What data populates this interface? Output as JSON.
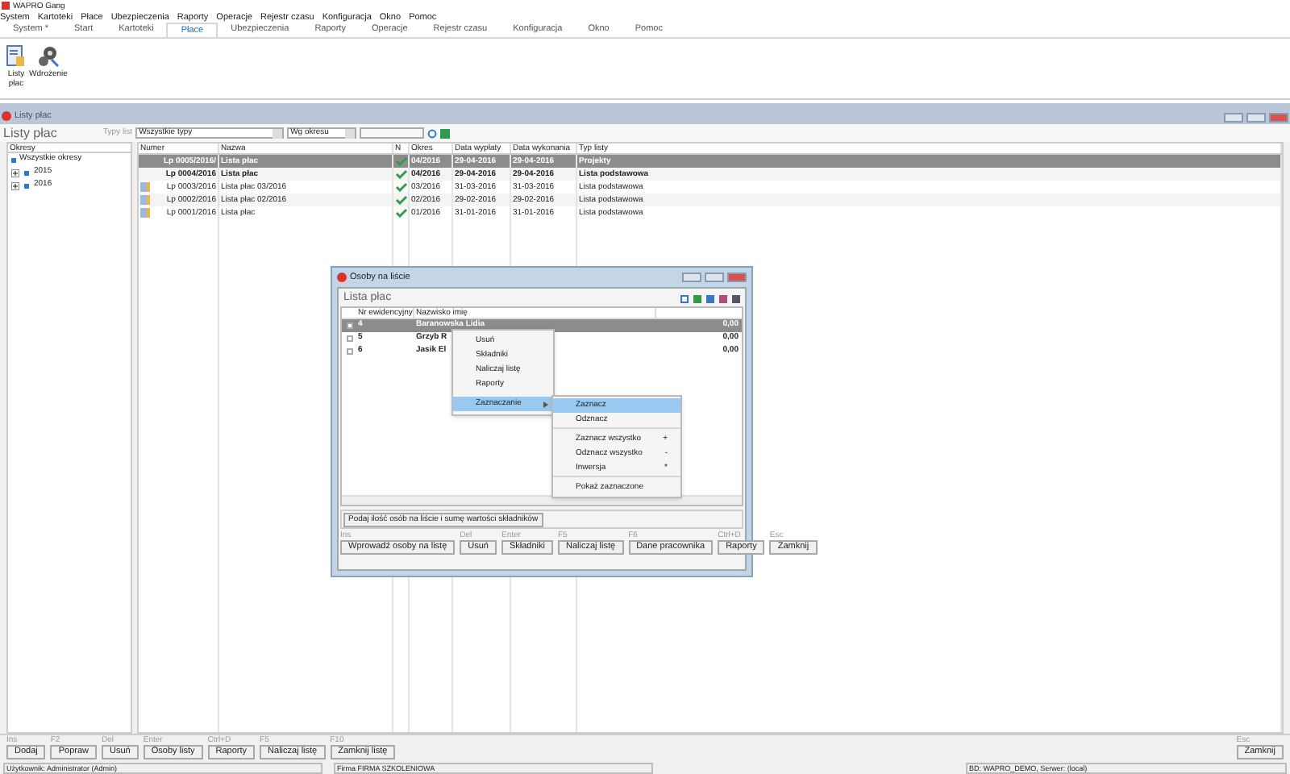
{
  "window": {
    "title": "WAPRO Gang"
  },
  "menu": [
    "System",
    "Kartoteki",
    "Płace",
    "Ubezpieczenia",
    "Raporty",
    "Operacje",
    "Rejestr czasu",
    "Konfiguracja",
    "Okno",
    "Pomoc"
  ],
  "tabs": [
    {
      "label": "System *",
      "selected": false
    },
    {
      "label": "Start",
      "selected": false
    },
    {
      "label": "Kartoteki",
      "selected": false
    },
    {
      "label": "Płace",
      "selected": true
    },
    {
      "label": "Ubezpieczenia",
      "selected": false
    },
    {
      "label": "Raporty",
      "selected": false
    },
    {
      "label": "Operacje",
      "selected": false
    },
    {
      "label": "Rejestr czasu",
      "selected": false
    },
    {
      "label": "Konfiguracja",
      "selected": false
    },
    {
      "label": "Okno",
      "selected": false
    },
    {
      "label": "Pomoc",
      "selected": false
    }
  ],
  "ribbon": [
    {
      "label": "Listy płac",
      "kind": "list"
    },
    {
      "label": "Wdrożenie",
      "kind": "gears"
    }
  ],
  "child_window": {
    "title": "Listy płac",
    "heading": "Listy płac",
    "filter_label": "Typy list",
    "type_value": "Wszystkie typy",
    "period_value": "Wg okresu"
  },
  "tree": {
    "header": "Okresy",
    "root": "Wszystkie okresy",
    "children": [
      {
        "label": "2015",
        "expanded": false
      },
      {
        "label": "2016",
        "expanded": false
      }
    ]
  },
  "table": {
    "columns": [
      "Numer",
      "Nazwa",
      "N",
      "Okres",
      "Data wypłaty",
      "Data wykonania",
      "Typ listy"
    ],
    "rows": [
      {
        "cells": [
          "Lp 0005/2016/",
          "Lista płac",
          "",
          "04/2016",
          "29-04-2016",
          "29-04-2016",
          "Projekty"
        ],
        "checked": true,
        "selected": true,
        "bold": true,
        "document_icon": false
      },
      {
        "cells": [
          "Lp 0004/2016",
          "Lista płac",
          "",
          "04/2016",
          "29-04-2016",
          "29-04-2016",
          "Lista podstawowa"
        ],
        "checked": true,
        "selected": false,
        "bold": true,
        "document_icon": false
      },
      {
        "cells": [
          "Lp 0003/2016",
          "Lista płac 03/2016",
          "",
          "03/2016",
          "31-03-2016",
          "31-03-2016",
          "Lista podstawowa"
        ],
        "checked": true,
        "selected": false,
        "bold": false,
        "document_icon": true
      },
      {
        "cells": [
          "Lp 0002/2016",
          "Lista płac 02/2016",
          "",
          "02/2016",
          "29-02-2016",
          "29-02-2016",
          "Lista podstawowa"
        ],
        "checked": true,
        "selected": false,
        "bold": false,
        "document_icon": true
      },
      {
        "cells": [
          "Lp 0001/2016",
          "Lista płac",
          "",
          "01/2016",
          "31-01-2016",
          "31-01-2016",
          "Lista podstawowa"
        ],
        "checked": true,
        "selected": false,
        "bold": false,
        "document_icon": true
      }
    ]
  },
  "bottom_actions": [
    {
      "key": "Ins",
      "label": "Dodaj"
    },
    {
      "key": "F2",
      "label": "Popraw"
    },
    {
      "key": "Del",
      "label": "Usuń"
    },
    {
      "key": "Enter",
      "label": "Osoby listy"
    },
    {
      "key": "Ctrl+D",
      "label": "Raporty"
    },
    {
      "key": "F5",
      "label": "Naliczaj listę"
    },
    {
      "key": "F10",
      "label": "Zamknij listę"
    }
  ],
  "close_action": {
    "key": "Esc",
    "label": "Zamknij"
  },
  "status_bar": [
    "Użytkownik: Administrator (Admin)",
    "Firma FIRMA SZKOLENIOWA",
    "BD: WAPRO_DEMO, Serwer: (local)"
  ],
  "dialog": {
    "title": "Osoby na liście",
    "heading": "Lista płac",
    "columns": [
      "Nr ewidencyjny",
      "Nazwisko imię"
    ],
    "rows": [
      {
        "number": "4",
        "name": "Baranowska Lidia",
        "value": "0,00",
        "selected": true,
        "checked": false
      },
      {
        "number": "5",
        "name": "Grzyb R",
        "value": "0,00",
        "selected": false,
        "checked": false
      },
      {
        "number": "6",
        "name": "Jasik El",
        "value": "0,00",
        "selected": false,
        "checked": false
      }
    ],
    "summary_button": "Podaj ilość osób na liście i sumę wartości składników",
    "actions": [
      {
        "key": "Ins",
        "label": "Wprowadź osoby na listę"
      },
      {
        "key": "Del",
        "label": "Usuń"
      },
      {
        "key": "Enter",
        "label": "Składniki"
      },
      {
        "key": "F5",
        "label": "Naliczaj listę"
      },
      {
        "key": "F6",
        "label": "Dane pracownika"
      },
      {
        "key": "Ctrl+D",
        "label": "Raporty"
      },
      {
        "key": "Esc",
        "label": "Zamknij"
      }
    ]
  },
  "context_menu": [
    {
      "label": "Usuń",
      "selected": false,
      "submenu": false
    },
    {
      "label": "Składniki",
      "selected": false,
      "submenu": false
    },
    {
      "label": "Naliczaj listę",
      "selected": false,
      "submenu": false
    },
    {
      "label": "Raporty",
      "selected": false,
      "submenu": false
    },
    {
      "label": "Zaznaczanie",
      "selected": true,
      "submenu": true
    }
  ],
  "submenu": [
    {
      "label": "Zaznacz",
      "selected": true,
      "separator_before": false
    },
    {
      "label": "Odznacz",
      "selected": false,
      "separator_before": false
    },
    {
      "label": "Zaznacz wszystko",
      "shortcut": "+",
      "selected": false,
      "separator_before": true
    },
    {
      "label": "Odznacz wszystko",
      "shortcut": "-",
      "selected": false,
      "separator_before": false
    },
    {
      "label": "Inwersja",
      "shortcut": "*",
      "selected": false,
      "separator_before": false
    },
    {
      "label": "Pokaż zaznaczone",
      "selected": false,
      "separator_before": true
    }
  ]
}
